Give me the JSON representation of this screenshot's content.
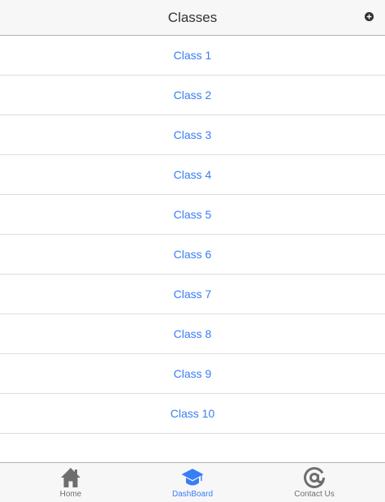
{
  "header": {
    "title": "Classes",
    "add_icon": "plus-circle-icon"
  },
  "classes": [
    "Class 1",
    "Class 2",
    "Class 3",
    "Class 4",
    "Class 5",
    "Class 6",
    "Class 7",
    "Class 8",
    "Class 9",
    "Class 10"
  ],
  "tabs": [
    {
      "label": "Home",
      "icon": "home-icon",
      "active": false
    },
    {
      "label": "DashBoard",
      "icon": "graduation-cap-icon",
      "active": true
    },
    {
      "label": "Contact Us",
      "icon": "at-icon",
      "active": false
    }
  ],
  "colors": {
    "accent": "#387ef5",
    "inactive": "#6e6e6e",
    "bar_background": "#f7f7f7",
    "divider": "#dddddd"
  }
}
